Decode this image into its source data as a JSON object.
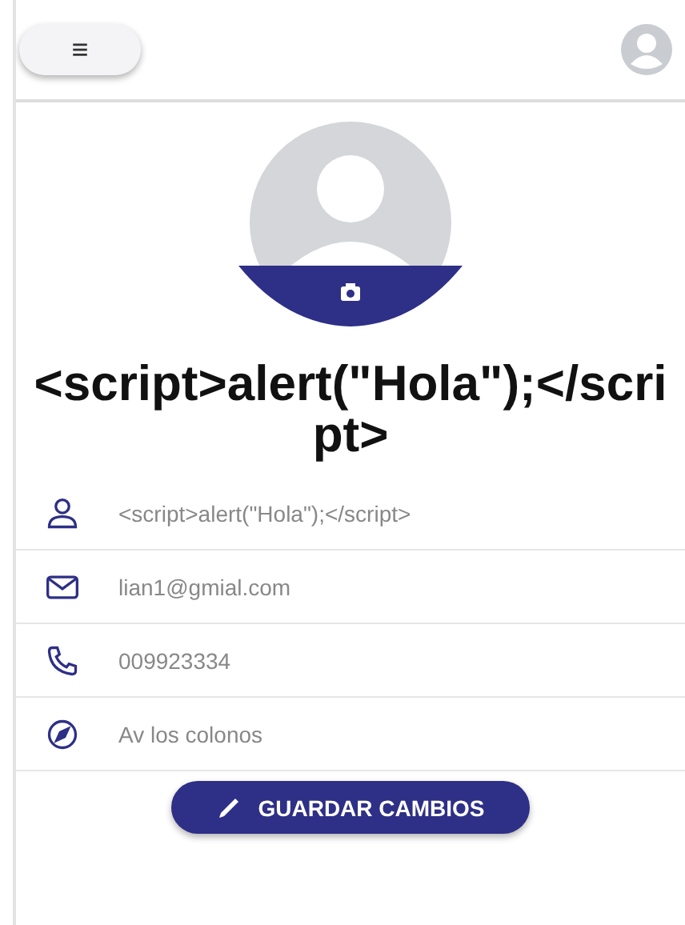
{
  "header": {
    "menu_icon": "≡"
  },
  "profile": {
    "name": "<script>alert(\"Hola\");</script>"
  },
  "fields": [
    {
      "kind": "user",
      "value": "<script>alert(\"Hola\");</script>"
    },
    {
      "kind": "email",
      "value": "lian1@gmial.com"
    },
    {
      "kind": "phone",
      "value": "009923334"
    },
    {
      "kind": "address",
      "value": "Av los colonos"
    }
  ],
  "save_button": {
    "label": "GUARDAR CAMBIOS"
  }
}
